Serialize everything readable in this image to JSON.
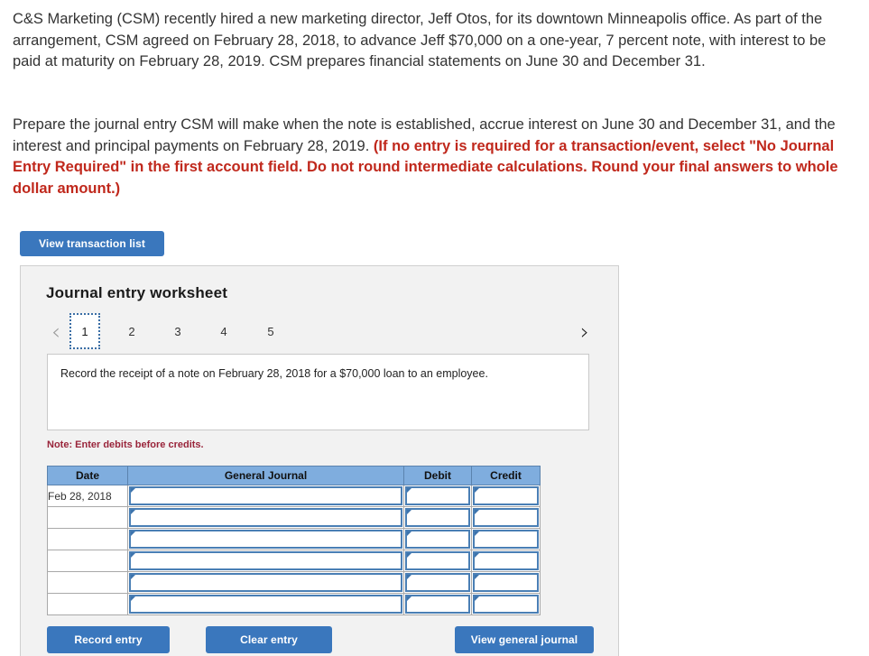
{
  "problem": {
    "paragraph1": "C&S Marketing (CSM) recently hired a new marketing director, Jeff Otos, for its downtown Minneapolis office. As part of the arrangement, CSM agreed on February 28, 2018, to advance Jeff $70,000 on a one-year, 7 percent note, with interest to be paid at maturity on February 28, 2019. CSM prepares financial statements on June 30 and December 31.",
    "paragraph2_lead": "Prepare the journal entry CSM will make when the note is established, accrue interest on June 30 and December 31, and the interest and principal payments on February 28, 2019. ",
    "paragraph2_requirement": "(If no entry is required for a transaction/event, select \"No Journal Entry Required\" in the first account field. Do not round intermediate calculations. Round your final answers to whole dollar amount.)"
  },
  "toolbar": {
    "view_transaction_list_label": "View transaction list"
  },
  "worksheet": {
    "title": "Journal entry worksheet",
    "pager": {
      "prev_icon": "chevron-left-icon",
      "prev_glyph": "‹",
      "next_icon": "chevron-right-icon",
      "next_glyph": "›",
      "prev_enabled": false,
      "next_enabled": true,
      "pages": [
        "1",
        "2",
        "3",
        "4",
        "5"
      ],
      "active_page": "1"
    },
    "transaction_description": "Record the receipt of a note on February 28, 2018 for a $70,000 loan to an employee.",
    "debit_note": "Note: Enter debits before credits.",
    "table": {
      "columns": [
        "Date",
        "General Journal",
        "Debit",
        "Credit"
      ],
      "rows": [
        {
          "date": "Feb 28, 2018",
          "general_journal": "",
          "debit": "",
          "credit": ""
        },
        {
          "date": "",
          "general_journal": "",
          "debit": "",
          "credit": ""
        },
        {
          "date": "",
          "general_journal": "",
          "debit": "",
          "credit": ""
        },
        {
          "date": "",
          "general_journal": "",
          "debit": "",
          "credit": ""
        },
        {
          "date": "",
          "general_journal": "",
          "debit": "",
          "credit": ""
        },
        {
          "date": "",
          "general_journal": "",
          "debit": "",
          "credit": ""
        }
      ]
    },
    "actions": {
      "record_entry_label": "Record entry",
      "clear_entry_label": "Clear entry",
      "view_general_journal_label": "View general journal"
    }
  },
  "colors": {
    "accent_blue": "#3a77bd",
    "table_header_blue": "#7fadde",
    "field_border_blue": "#4a7fb5",
    "requirement_red": "#c0281c",
    "note_red": "#99243a",
    "panel_bg": "#f2f2f2"
  }
}
